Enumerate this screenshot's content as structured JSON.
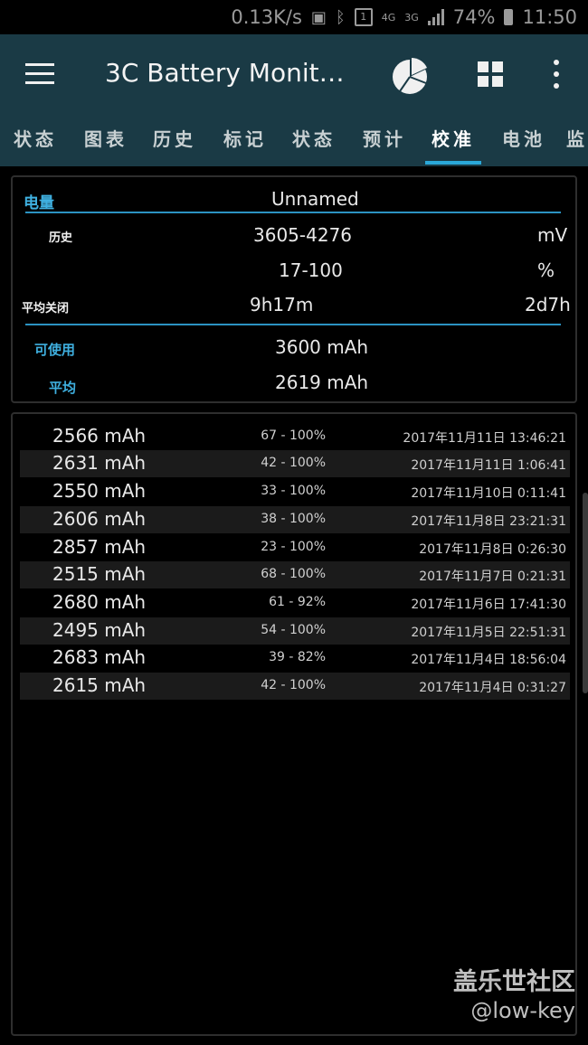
{
  "status_bar": {
    "speed": "0.13K/s",
    "icon_names": [
      "sim-icon",
      "bluetooth-icon",
      "notification-icon",
      "4g-icon",
      "3g-icon",
      "signal-icon",
      "battery-icon"
    ],
    "sim_slot": "1",
    "net_4g": "4G",
    "net_3g": "3G",
    "battery": "74%",
    "time": "11:50"
  },
  "app_bar": {
    "title": "3C Battery Monit…",
    "background": "#1a3a45"
  },
  "tabs": [
    {
      "label": "状态"
    },
    {
      "label": "图表"
    },
    {
      "label": "历史"
    },
    {
      "label": "标记"
    },
    {
      "label": "状态"
    },
    {
      "label": "预计"
    },
    {
      "label": "校准",
      "active": true
    },
    {
      "label": "电池"
    },
    {
      "label": "监"
    }
  ],
  "accent_color": "#2aa8d8",
  "summary": {
    "section_label": "电量",
    "name": "Unnamed",
    "history_label": "历史",
    "voltage_range": "3605-4276",
    "voltage_unit": "mV",
    "percent_range": "17-100",
    "percent_unit": "%",
    "avg_off_label": "平均关闭",
    "avg_off_time": "9h17m",
    "avg_off_right": "2d7h",
    "usable_label": "可使用",
    "usable_value": "3600 mAh",
    "average_label": "平均",
    "average_value": "2619 mAh"
  },
  "records": [
    {
      "capacity": "2566 mAh",
      "range": "67 - 100%",
      "date": "2017年11月11日 13:46:21"
    },
    {
      "capacity": "2631 mAh",
      "range": "42 - 100%",
      "date": "2017年11月11日 1:06:41"
    },
    {
      "capacity": "2550 mAh",
      "range": "33 - 100%",
      "date": "2017年11月10日 0:11:41"
    },
    {
      "capacity": "2606 mAh",
      "range": "38 - 100%",
      "date": "2017年11月8日 23:21:31"
    },
    {
      "capacity": "2857 mAh",
      "range": "23 - 100%",
      "date": "2017年11月8日 0:26:30"
    },
    {
      "capacity": "2515 mAh",
      "range": "68 - 100%",
      "date": "2017年11月7日 0:21:31"
    },
    {
      "capacity": "2680 mAh",
      "range": "61 - 92%",
      "date": "2017年11月6日 17:41:30"
    },
    {
      "capacity": "2495 mAh",
      "range": "54 - 100%",
      "date": "2017年11月5日 22:51:31"
    },
    {
      "capacity": "2683 mAh",
      "range": "39 - 82%",
      "date": "2017年11月4日 18:56:04"
    },
    {
      "capacity": "2615 mAh",
      "range": "42 - 100%",
      "date": "2017年11月4日 0:31:27"
    }
  ],
  "watermark": {
    "line1": "盖乐世社区",
    "line2": "@low-key"
  }
}
